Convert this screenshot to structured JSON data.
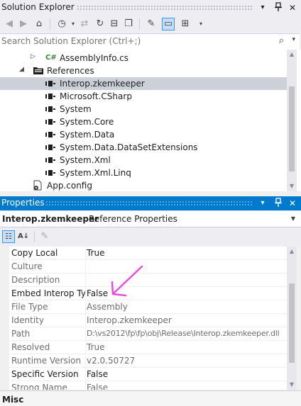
{
  "solution_explorer": {
    "title": "Solution Explorer",
    "window_controls": {
      "dropdown": "▾",
      "pin": "⊓",
      "close": "✕"
    },
    "search": {
      "placeholder": "Search Solution Explorer (Ctrl+;)"
    },
    "tree": [
      {
        "label": "AssemblyInfo.cs",
        "icon": "csharp-file-icon",
        "icon_text": "C#",
        "expander": "▷",
        "level": 2
      },
      {
        "label": "References",
        "icon": "references-folder-icon",
        "expander": "◢",
        "level": 1
      },
      {
        "label": "Interop.zkemkeeper",
        "icon": "reference-icon",
        "level": 2,
        "selected": true
      },
      {
        "label": "Microsoft.CSharp",
        "icon": "reference-icon",
        "level": 2
      },
      {
        "label": "System",
        "icon": "reference-icon",
        "level": 2
      },
      {
        "label": "System.Core",
        "icon": "reference-icon",
        "level": 2
      },
      {
        "label": "System.Data",
        "icon": "reference-icon",
        "level": 2
      },
      {
        "label": "System.Data.DataSetExtensions",
        "icon": "reference-icon",
        "level": 2
      },
      {
        "label": "System.Xml",
        "icon": "reference-icon",
        "level": 2
      },
      {
        "label": "System.Xml.Linq",
        "icon": "reference-icon",
        "level": 2
      },
      {
        "label": "App.config",
        "icon": "config-file-icon",
        "level": 1
      }
    ]
  },
  "properties": {
    "title": "Properties",
    "window_controls": {
      "dropdown": "▾",
      "pin": "⊓",
      "close": "✕"
    },
    "object_name": "Interop.zkemkeeper",
    "object_kind": "Reference Properties",
    "rows": [
      {
        "name": "Copy Local",
        "value": "True",
        "readonly": false
      },
      {
        "name": "Culture",
        "value": "",
        "readonly": true
      },
      {
        "name": "Description",
        "value": "",
        "readonly": true
      },
      {
        "name": "Embed Interop Typ",
        "value": "False",
        "readonly": false
      },
      {
        "name": "File Type",
        "value": "Assembly",
        "readonly": true
      },
      {
        "name": "Identity",
        "value": "Interop.zkemkeeper",
        "readonly": true
      },
      {
        "name": "Path",
        "value": "D:\\vs2012\\fp\\fp\\obj\\Release\\Interop.zkemkeeper.dll",
        "readonly": true
      },
      {
        "name": "Resolved",
        "value": "True",
        "readonly": true
      },
      {
        "name": "Runtime Version",
        "value": "v2.0.50727",
        "readonly": true
      },
      {
        "name": "Specific Version",
        "value": "False",
        "readonly": false
      },
      {
        "name": "Strong Name",
        "value": "False",
        "readonly": true
      }
    ],
    "footer_category": "Misc"
  },
  "colors": {
    "accent": "#007acc",
    "selection": "#ccd1d9",
    "annotation_arrow": "#e84fd9"
  }
}
